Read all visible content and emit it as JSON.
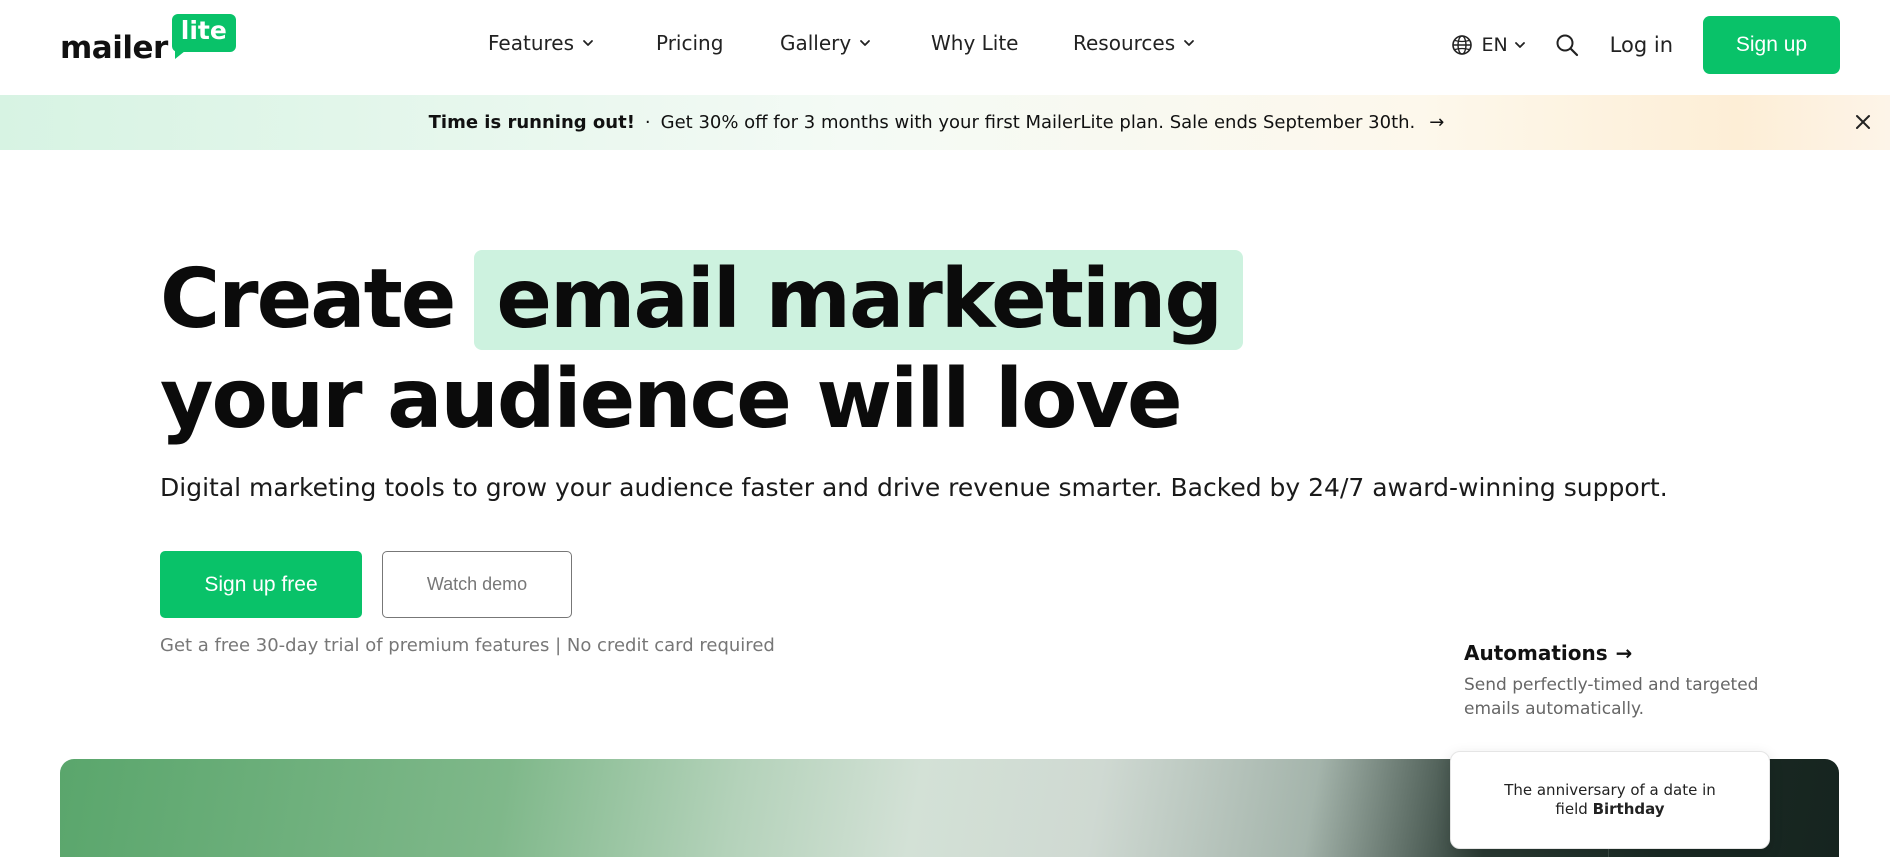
{
  "header": {
    "logo": {
      "word": "mailer",
      "badge": "lite"
    },
    "nav": {
      "features": "Features",
      "pricing": "Pricing",
      "gallery": "Gallery",
      "why_lite": "Why Lite",
      "resources": "Resources"
    },
    "language": "EN",
    "login": "Log in",
    "signup": "Sign up"
  },
  "promo": {
    "strong": "Time is running out!",
    "separator": "·",
    "message": "Get 30% off for 3 months with your first MailerLite plan. Sale ends September 30th.",
    "arrow": "→"
  },
  "hero": {
    "title_prefix": "Create",
    "title_highlight": "email marketing",
    "title_line2": "your audience will love",
    "subtitle": "Digital marketing tools to grow your audience faster and drive revenue smarter. Backed by 24/7 award-winning support.",
    "cta_primary": "Sign up free",
    "cta_secondary": "Watch demo",
    "note": "Get a free 30-day trial of premium features | No credit card required"
  },
  "feature": {
    "title": "Automations",
    "arrow": "→",
    "description": "Send perfectly-timed and targeted emails automatically."
  },
  "card": {
    "text": "The anniversary of a date in field",
    "bold": "Birthday"
  },
  "colors": {
    "brand_green": "#09c269",
    "highlight": "#cdf2df"
  }
}
